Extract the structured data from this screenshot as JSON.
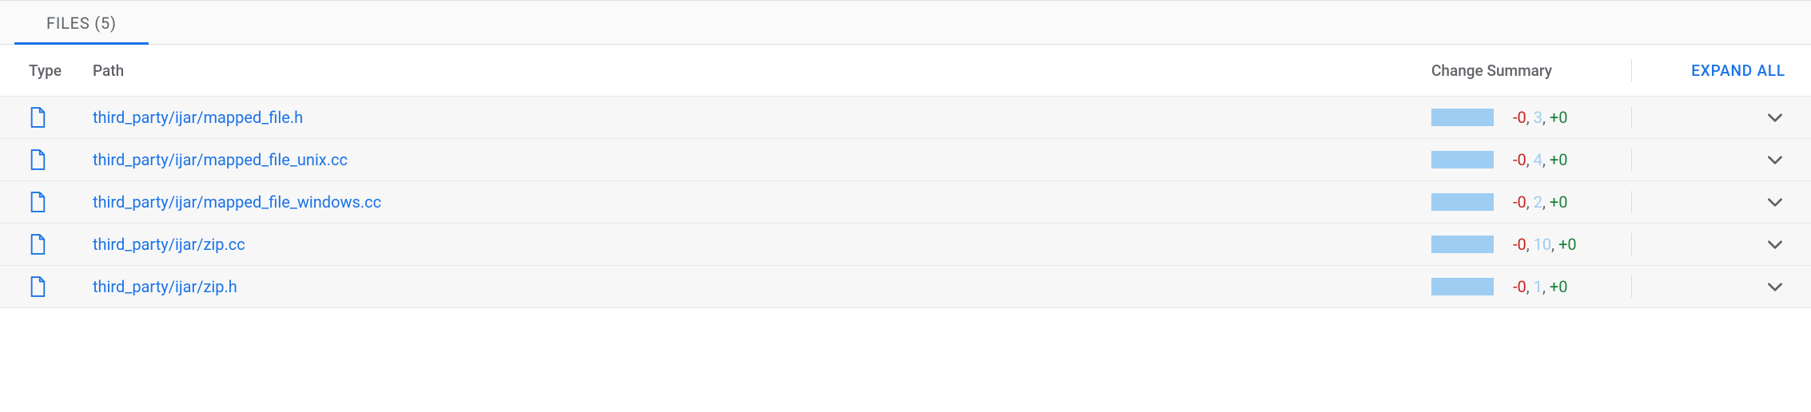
{
  "tab": {
    "label": "FILES (5)"
  },
  "header": {
    "type": "Type",
    "path": "Path",
    "change_summary": "Change Summary",
    "expand_all": "EXPAND ALL"
  },
  "rows": [
    {
      "path": "third_party/ijar/mapped_file.h",
      "neg": "-0",
      "mid": "3",
      "pos": "+0"
    },
    {
      "path": "third_party/ijar/mapped_file_unix.cc",
      "neg": "-0",
      "mid": "4",
      "pos": "+0"
    },
    {
      "path": "third_party/ijar/mapped_file_windows.cc",
      "neg": "-0",
      "mid": "2",
      "pos": "+0"
    },
    {
      "path": "third_party/ijar/zip.cc",
      "neg": "-0",
      "mid": "10",
      "pos": "+0"
    },
    {
      "path": "third_party/ijar/zip.h",
      "neg": "-0",
      "mid": "1",
      "pos": "+0"
    }
  ],
  "sep": ", "
}
